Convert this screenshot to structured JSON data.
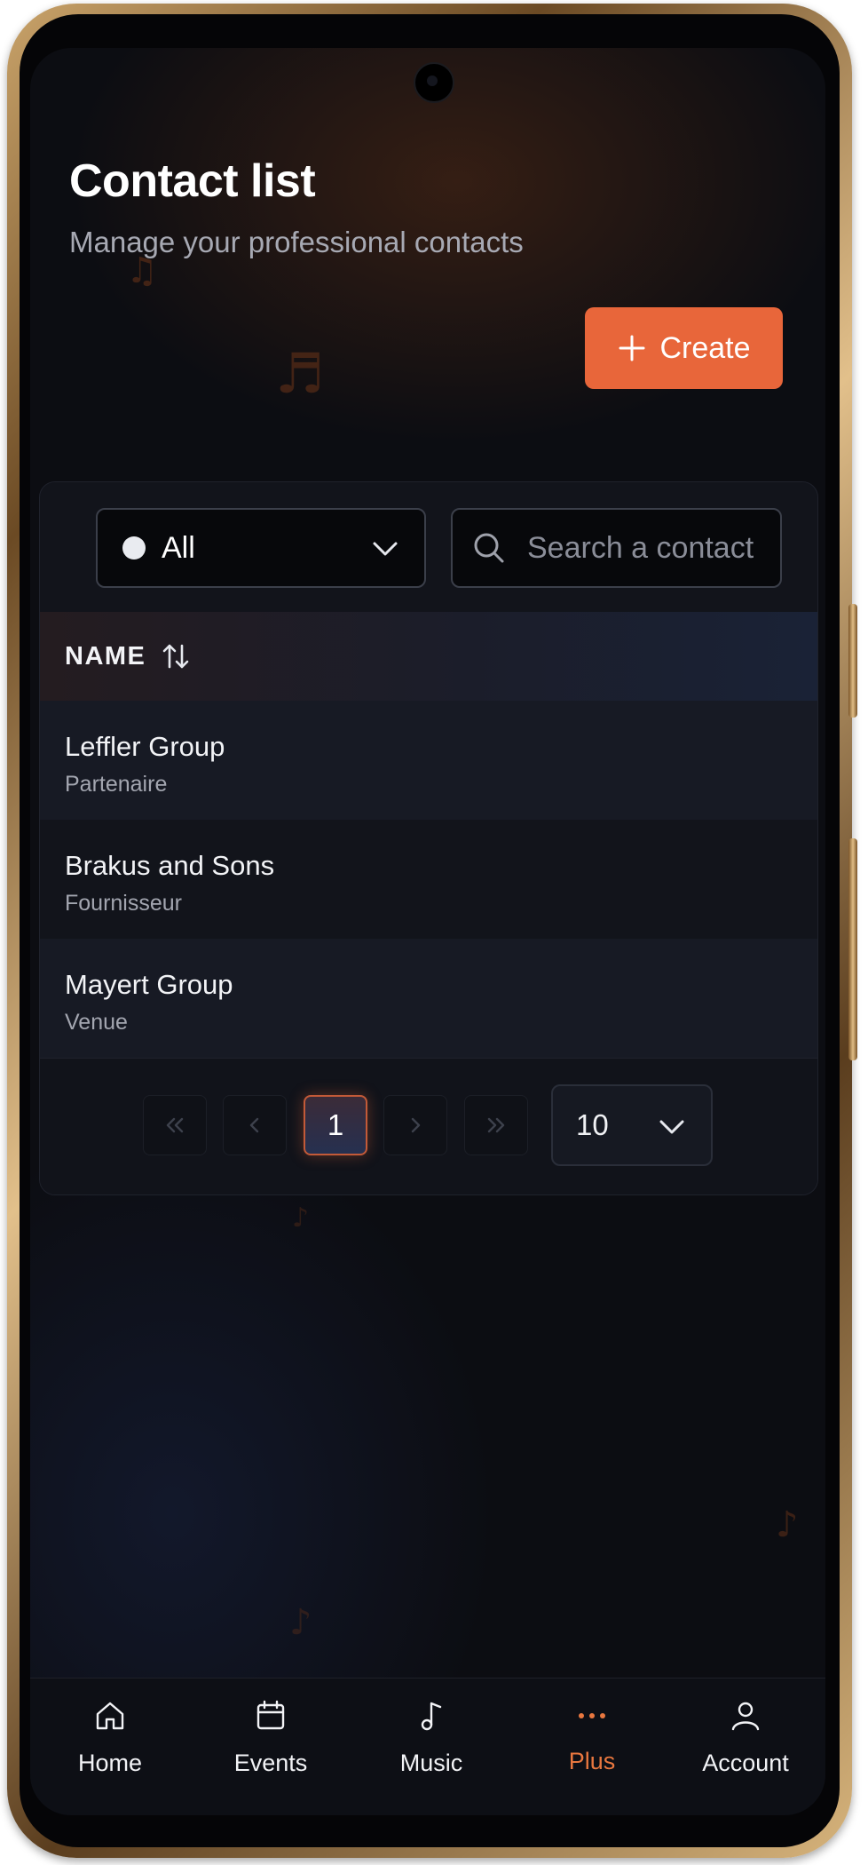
{
  "page": {
    "title": "Contact list",
    "subtitle": "Manage your professional contacts",
    "create_label": "Create"
  },
  "filters": {
    "status": {
      "selected": "All"
    },
    "search": {
      "placeholder": "Search a contact"
    }
  },
  "table": {
    "column_header": "NAME",
    "rows": [
      {
        "name": "Leffler Group",
        "type": "Partenaire"
      },
      {
        "name": "Brakus and Sons",
        "type": "Fournisseur"
      },
      {
        "name": "Mayert Group",
        "type": "Venue"
      }
    ]
  },
  "pagination": {
    "current_page": "1",
    "per_page": "10"
  },
  "nav": {
    "items": [
      {
        "label": "Home",
        "icon": "home-icon"
      },
      {
        "label": "Events",
        "icon": "calendar-icon"
      },
      {
        "label": "Music",
        "icon": "music-note-icon"
      },
      {
        "label": "Plus",
        "icon": "more-dots-icon"
      },
      {
        "label": "Account",
        "icon": "user-icon"
      }
    ],
    "active": "Plus"
  },
  "colors": {
    "accent": "#e8663a",
    "background": "#0c0d12",
    "card": "#12141b"
  }
}
